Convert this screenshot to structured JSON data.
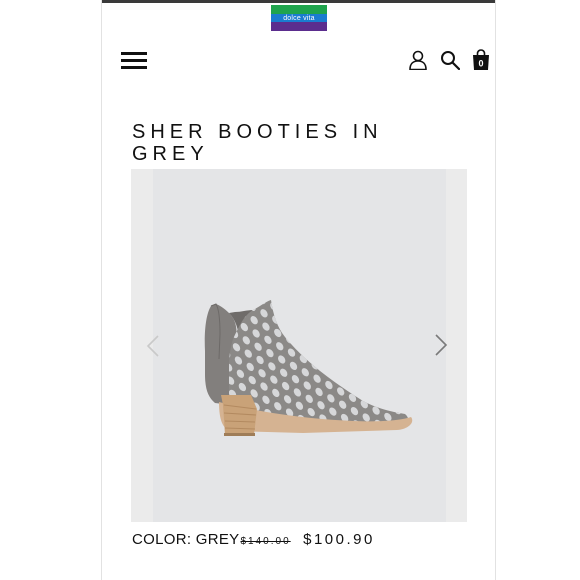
{
  "brand": {
    "logo_text": "dolce vita",
    "logo_colors": [
      "#1fa44d",
      "#1a7ccf",
      "#5b2d8e"
    ]
  },
  "header": {
    "icons": [
      "menu-icon",
      "account-icon",
      "search-icon",
      "cart-icon"
    ],
    "cart_count": "0"
  },
  "product": {
    "title": "SHER BOOTIES IN GREY",
    "color_label": "COLOR:",
    "color_value": "GREY",
    "original_price": "$140.00",
    "sale_price": "$100.90",
    "image": "grey perforated suede ankle bootie with stacked wooden heel",
    "colors": {
      "boot": "#8d8b89",
      "heel": "#c9a278",
      "sole": "#d8b595",
      "background": "#e4e5e7"
    }
  },
  "gallery": {
    "controls": [
      "chevron-left-icon",
      "chevron-right-icon"
    ]
  }
}
